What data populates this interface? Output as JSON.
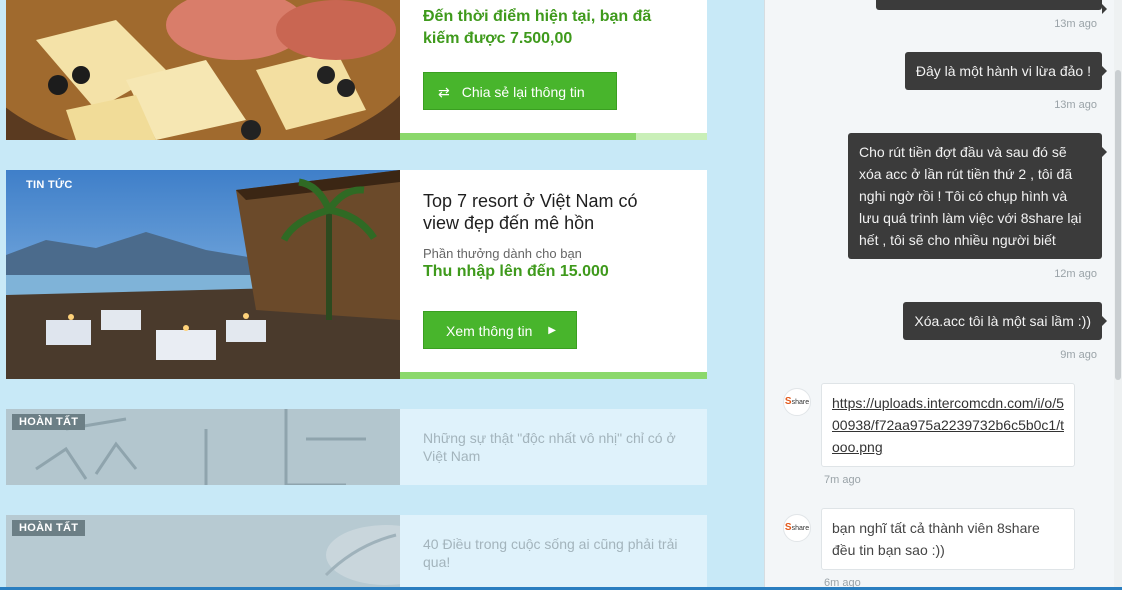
{
  "feed": {
    "card1": {
      "earned_text": "Đến thời điểm hiện tại, bạn đã kiếm được 7.500,00",
      "share_button": "Chia sẻ lại thông tin",
      "progress": 0.77
    },
    "card2": {
      "badge": "TIN TỨC",
      "title": "Top 7 resort ở Việt Nam có view đẹp đến mê hồn",
      "reward_label": "Phần thưởng dành cho bạn",
      "reward_value": "Thu nhập lên đến 15.000",
      "view_button": "Xem thông tin",
      "progress": 1.0
    },
    "card3": {
      "badge": "HOÀN TẤT",
      "title": "Những sự thật \"độc nhất vô nhị\" chỉ có ở Việt Nam"
    },
    "card4": {
      "badge": "HOÀN TẤT",
      "title": "40 Điều trong cuộc sống ai cũng phải trải qua!"
    }
  },
  "chat": {
    "messages": [
      {
        "text": "",
        "time": "13m ago"
      },
      {
        "text": "Đây là một hành vi lừa đảo !",
        "time": "13m ago"
      },
      {
        "text": "Cho rút tiền đợt đầu và sau đó sẽ xóa acc ở lần rút tiền thứ 2 , tôi đã nghi ngờ rồi ! Tôi có chụp hình và lưu quá trình làm việc với 8share lại hết , tôi sẽ cho nhiều người biết",
        "time": "12m ago"
      },
      {
        "text": "Xóa.acc tôi là một sai lầm :))",
        "time": "9m ago"
      },
      {
        "text": "https://uploads.intercomcdn.com/i/o/500938/f72aa975a2239732b6c5b0c1/tooo.png",
        "time": "7m ago"
      },
      {
        "text": "bạn nghĩ tất cả thành viên 8share đều tin bạn sao :))",
        "time": "6m ago"
      }
    ],
    "avatar_label": "share"
  },
  "colors": {
    "page_bg": "#c8e9f7",
    "accent_green": "#48b52c",
    "reward_green": "#3f9a1c",
    "user_bubble": "#3b3b3b"
  }
}
